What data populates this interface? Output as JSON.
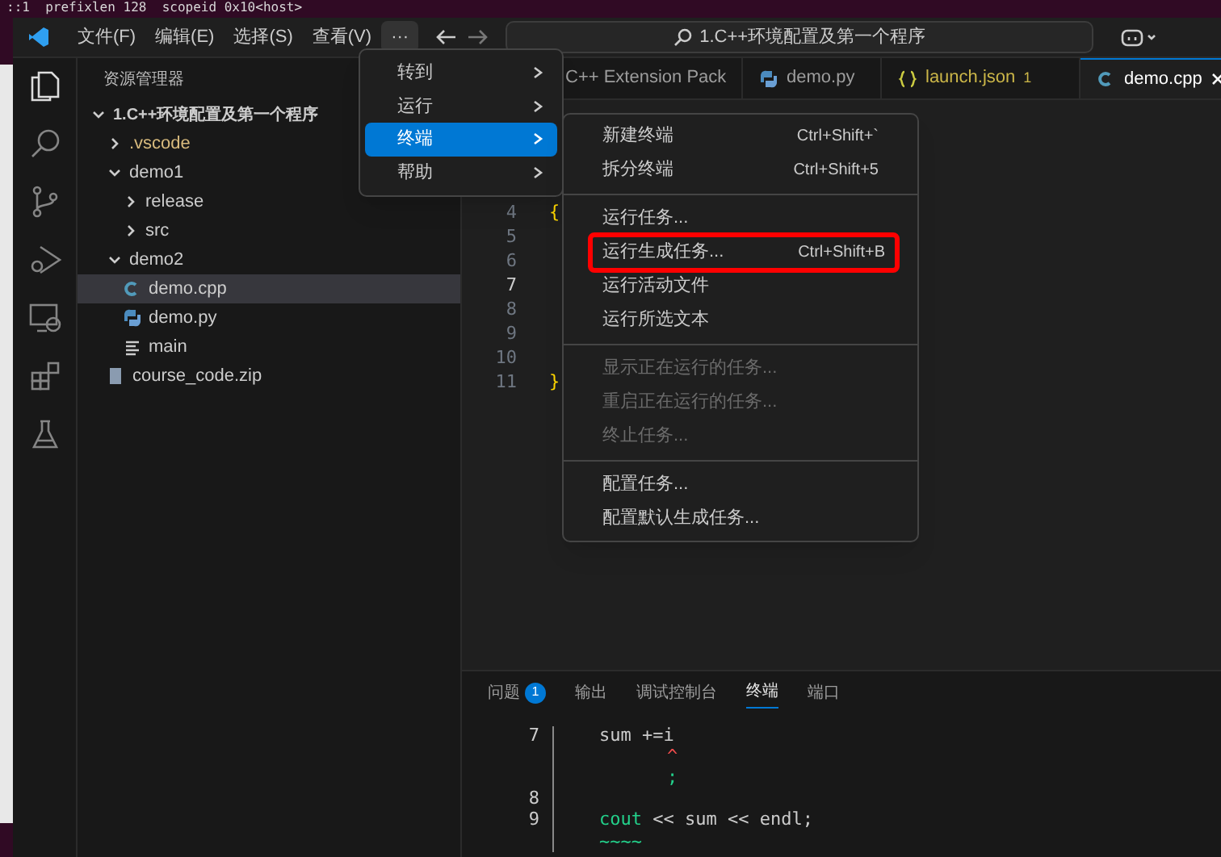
{
  "background_terminal": {
    "line": "::1  prefixlen 128  scopeid 0x10<host>"
  },
  "menubar": [
    {
      "label": "文件(F)",
      "selected": false
    },
    {
      "label": "编辑(E)",
      "selected": false
    },
    {
      "label": "选择(S)",
      "selected": false
    },
    {
      "label": "查看(V)",
      "selected": false
    },
    {
      "label": "···",
      "selected": true
    }
  ],
  "command_center": {
    "text": "1.C++环境配置及第一个程序"
  },
  "sidebar": {
    "title": "资源管理器",
    "tree": [
      {
        "label": "1.C++环境配置及第一个程序",
        "kind": "root",
        "expanded": true,
        "children": [
          {
            "label": ".vscode",
            "kind": "folder",
            "expanded": false
          },
          {
            "label": "demo1",
            "kind": "folder",
            "expanded": true,
            "children": [
              {
                "label": "release",
                "kind": "folder",
                "expanded": false
              },
              {
                "label": "src",
                "kind": "folder",
                "expanded": false
              }
            ]
          },
          {
            "label": "demo2",
            "kind": "folder",
            "expanded": true,
            "children": [
              {
                "label": "demo.cpp",
                "kind": "cpp",
                "selected": true
              },
              {
                "label": "demo.py",
                "kind": "py",
                "selected": false
              },
              {
                "label": "main",
                "kind": "text",
                "selected": false
              }
            ]
          },
          {
            "label": "course_code.zip",
            "kind": "zip",
            "selected": false
          }
        ]
      }
    ]
  },
  "tabs": [
    {
      "label": "C++ Extension Pack",
      "kind": "plain",
      "selected": false
    },
    {
      "label": "demo.py",
      "kind": "py",
      "selected": false
    },
    {
      "label": "launch.json",
      "kind": "json",
      "badge": "1",
      "selected": false
    },
    {
      "label": "demo.cpp",
      "kind": "cpp",
      "selected": true
    }
  ],
  "editor": {
    "lines": [
      {
        "number": "4",
        "code": "{",
        "current": false
      },
      {
        "number": "5",
        "current": false
      },
      {
        "number": "6",
        "current": false
      },
      {
        "number": "7",
        "current": true
      },
      {
        "number": "8",
        "current": false
      },
      {
        "number": "9",
        "current": false
      },
      {
        "number": "10",
        "current": false
      },
      {
        "number": "11",
        "code": "}",
        "current": false
      }
    ]
  },
  "menu": {
    "items": [
      {
        "label": "转到",
        "selected": false
      },
      {
        "label": "运行",
        "selected": false
      },
      {
        "label": "终端",
        "selected": true
      },
      {
        "label": "帮助",
        "selected": false
      }
    ]
  },
  "submenu": {
    "groups": [
      [
        {
          "label": "新建终端",
          "shortcut": "Ctrl+Shift+`",
          "disabled": false,
          "highlighted": false
        },
        {
          "label": "拆分终端",
          "shortcut": "Ctrl+Shift+5",
          "disabled": false,
          "highlighted": false
        }
      ],
      [
        {
          "label": "运行任务...",
          "disabled": false,
          "highlighted": false
        },
        {
          "label": "运行生成任务...",
          "shortcut": "Ctrl+Shift+B",
          "disabled": false,
          "highlighted": true
        },
        {
          "label": "运行活动文件",
          "disabled": false,
          "highlighted": false
        },
        {
          "label": "运行所选文本",
          "disabled": false,
          "highlighted": false
        }
      ],
      [
        {
          "label": "显示正在运行的任务...",
          "disabled": true,
          "highlighted": false
        },
        {
          "label": "重启正在运行的任务...",
          "disabled": true,
          "highlighted": false
        },
        {
          "label": "终止任务...",
          "disabled": true,
          "highlighted": false
        }
      ],
      [
        {
          "label": "配置任务...",
          "disabled": false,
          "highlighted": false
        },
        {
          "label": "配置默认生成任务...",
          "disabled": false,
          "highlighted": false
        }
      ]
    ]
  },
  "panel": {
    "tabs": [
      {
        "label": "问题",
        "badge": "1",
        "selected": false
      },
      {
        "label": "输出",
        "selected": false
      },
      {
        "label": "调试控制台",
        "selected": false
      },
      {
        "label": "终端",
        "selected": true
      },
      {
        "label": "端口",
        "selected": false
      }
    ],
    "terminal": [
      {
        "number": "7",
        "kind": "code",
        "text": "sum +=i"
      },
      {
        "kind": "caret",
        "text": "^"
      },
      {
        "kind": "fix",
        "text": ";"
      },
      {
        "number": "8",
        "kind": "code"
      },
      {
        "number": "9",
        "kind": "code",
        "keyword": "cout",
        "text": " << sum << endl;"
      },
      {
        "kind": "squiggle",
        "text": "~~~~"
      }
    ]
  }
}
